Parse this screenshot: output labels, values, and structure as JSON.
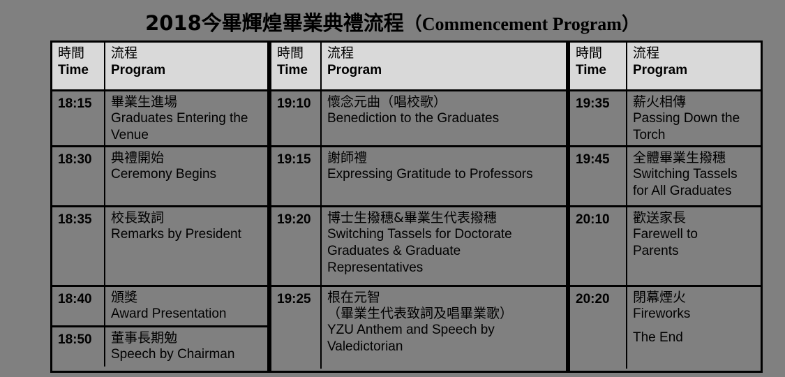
{
  "title": {
    "cjk": "2018今畢輝煌畢業典禮流程",
    "paren": "（Commencement Program）"
  },
  "headers": {
    "time_cjk": "時間",
    "time_en": "Time",
    "program_cjk": "流程",
    "program_en": "Program"
  },
  "colors": {
    "page_background": "#808080",
    "header_background": "#d9d9d9",
    "border": "#000000",
    "text": "#000000"
  },
  "columns": [
    {
      "rows": [
        {
          "time": "18:15",
          "cjk": "畢業生進場",
          "en": "Graduates Entering the",
          "en2": "Venue"
        },
        {
          "time": "18:30",
          "cjk": "典禮開始",
          "en": "Ceremony Begins"
        },
        {
          "time": "18:35",
          "cjk": "校長致詞",
          "en": "Remarks by President"
        },
        {
          "time": "18:40",
          "cjk": "頒獎",
          "en": "Award Presentation"
        },
        {
          "time": "18:50",
          "cjk": "董事長期勉",
          "en": "Speech by Chairman"
        }
      ]
    },
    {
      "rows": [
        {
          "time": "19:10",
          "cjk": "懷念元曲（唱校歌）",
          "en": "Benediction to the Graduates"
        },
        {
          "time": "19:15",
          "cjk": "謝師禮",
          "en": "Expressing Gratitude to Professors"
        },
        {
          "time": "19:20",
          "cjk": "博士生撥穗&畢業生代表撥穗",
          "en": "Switching Tassels for Doctorate",
          "en2": "Graduates & Graduate",
          "en3": "Representatives"
        },
        {
          "time": "19:25",
          "cjk": "根在元智",
          "cjk2": "（畢業生代表致詞及唱畢業歌）",
          "en": "YZU Anthem and Speech by",
          "en2": "Valedictorian"
        }
      ]
    },
    {
      "rows": [
        {
          "time": "19:35",
          "cjk": "薪火相傳",
          "en": "Passing Down the",
          "en2": "Torch"
        },
        {
          "time": "19:45",
          "cjk": "全體畢業生撥穗",
          "en": "Switching Tassels",
          "en2": "for All Graduates"
        },
        {
          "time": "20:10",
          "cjk": "歡送家長",
          "en": "Farewell to",
          "en2": "Parents"
        },
        {
          "time": "20:20",
          "cjk": "閉幕煙火",
          "en": "Fireworks",
          "en3": "The End"
        }
      ]
    }
  ]
}
